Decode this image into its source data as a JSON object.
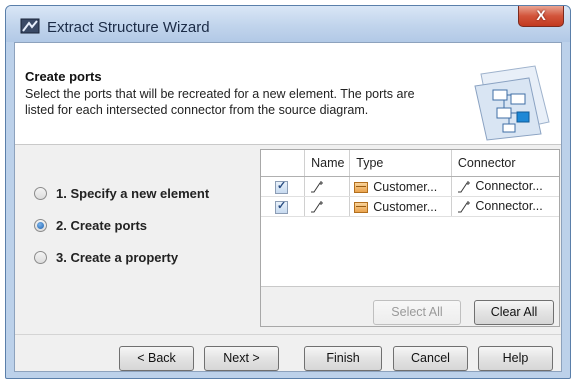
{
  "window": {
    "title": "Extract Structure Wizard",
    "close_label": "X"
  },
  "header": {
    "title": "Create ports",
    "description": "Select the ports that will be recreated for a new element. The ports are listed for each intersected connector from the source diagram."
  },
  "steps": [
    {
      "label": "1. Specify a new element",
      "selected": false
    },
    {
      "label": "2. Create ports",
      "selected": true
    },
    {
      "label": "3. Create a property",
      "selected": false
    }
  ],
  "ports_table": {
    "columns": [
      "",
      "Name",
      "Type",
      "Connector"
    ],
    "rows": [
      {
        "checked": true,
        "name": "",
        "type": "Customer...",
        "connector": "Connector..."
      },
      {
        "checked": true,
        "name": "",
        "type": "Customer...",
        "connector": "Connector..."
      }
    ]
  },
  "table_buttons": {
    "select_all": "Select All",
    "clear_all": "Clear All"
  },
  "footer_buttons": {
    "back": "< Back",
    "next": "Next >",
    "finish": "Finish",
    "cancel": "Cancel",
    "help": "Help"
  },
  "icons": {
    "app": "wizard-icon",
    "connector": "connector-icon",
    "type": "class-icon",
    "header_art": "structure-diagram-icon"
  },
  "colors": {
    "titlebar": "#c1d4ec",
    "close": "#d2543b",
    "radio_selected": "#1e62b0"
  }
}
